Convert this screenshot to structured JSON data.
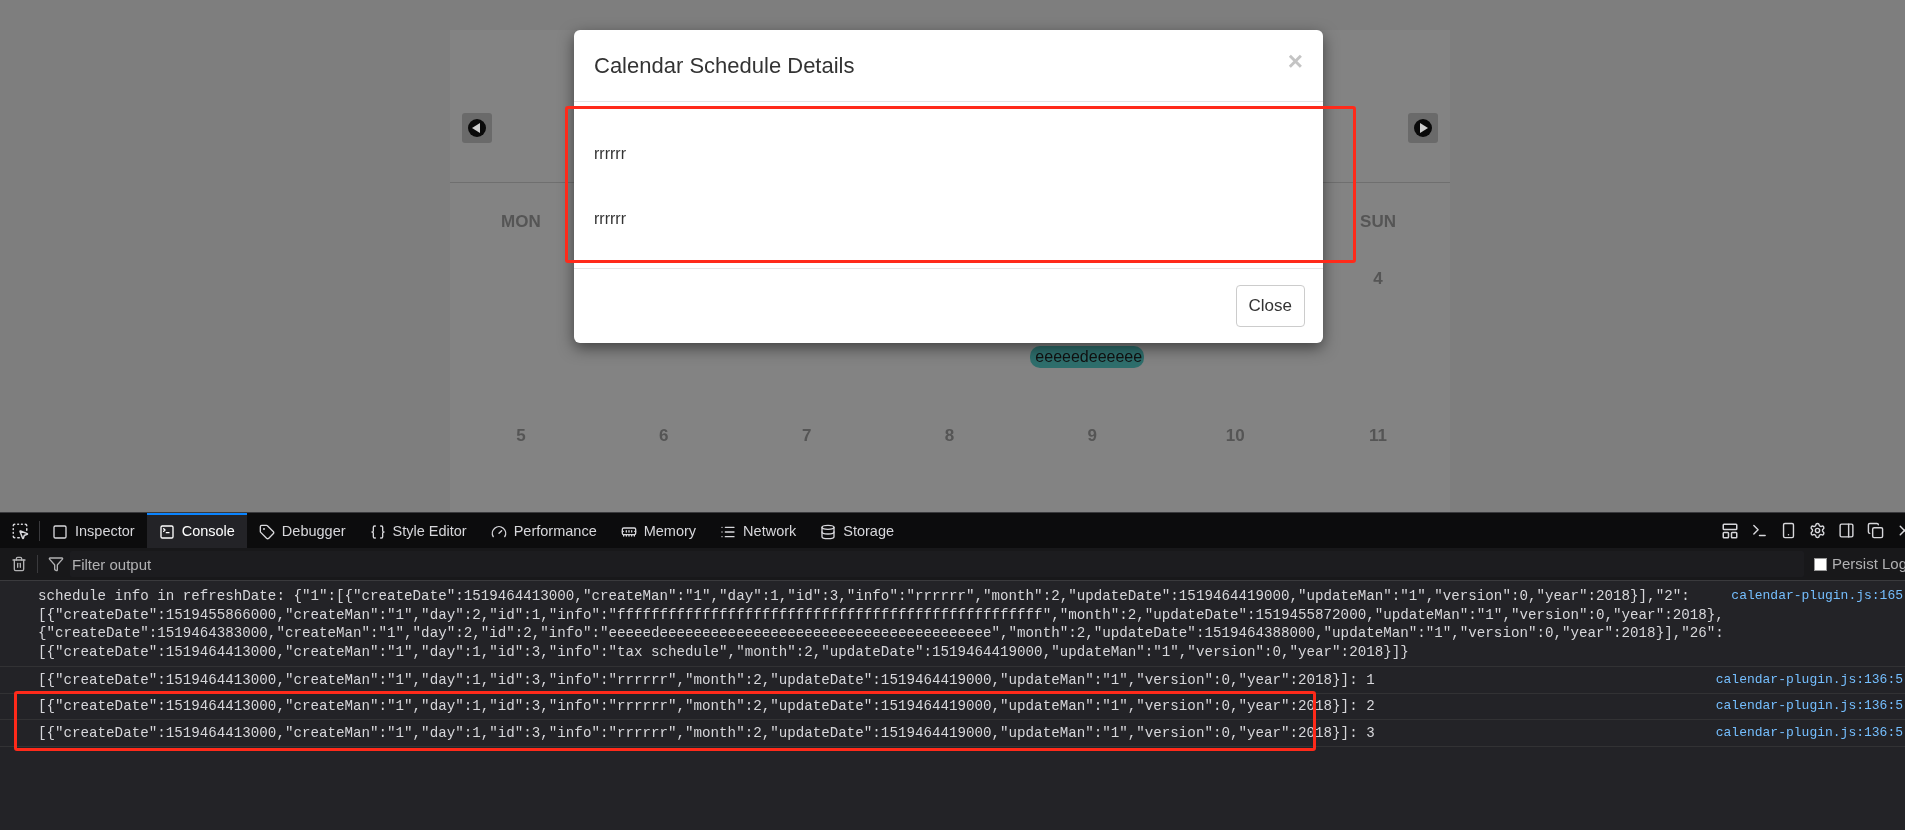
{
  "calendar": {
    "weekday_first": "MON",
    "weekday_last": "SUN",
    "week_1_last_day": "4",
    "event": "eeeeedeeeeee",
    "week_2": [
      "5",
      "6",
      "7",
      "8",
      "9",
      "10",
      "11"
    ]
  },
  "modal": {
    "title": "Calendar Schedule Details",
    "close_glyph": "×",
    "body_lines": [
      "rrrrrr",
      "rrrrrr"
    ],
    "button": "Close"
  },
  "devtools": {
    "tabs": [
      {
        "label": "Inspector",
        "selected": false
      },
      {
        "label": "Console",
        "selected": true
      },
      {
        "label": "Debugger",
        "selected": false
      },
      {
        "label": "Style Editor",
        "selected": false
      },
      {
        "label": "Performance",
        "selected": false
      },
      {
        "label": "Memory",
        "selected": false
      },
      {
        "label": "Network",
        "selected": false
      },
      {
        "label": "Storage",
        "selected": false
      }
    ],
    "filter_placeholder": "Filter output",
    "persist": {
      "label": "Persist Log",
      "checked": false
    },
    "messages": [
      {
        "lines": [
          "schedule info in refreshDate: {\"1\":[{\"createDate\":1519464413000,\"createMan\":\"1\",\"day\":1,\"id\":3,\"info\":\"rrrrrr\",\"month\":2,\"updateDate\":1519464419000,\"updateMan\":\"1\",\"version\":0,\"year\":2018}],\"2\":",
          "[{\"createDate\":1519455866000,\"createMan\":\"1\",\"day\":2,\"id\":1,\"info\":\"ffffffffffffffffffffffffffffffffffffffffffffffffff\",\"month\":2,\"updateDate\":1519455872000,\"updateMan\":\"1\",\"version\":0,\"year\":2018},",
          "{\"createDate\":1519464383000,\"createMan\":\"1\",\"day\":2,\"id\":2,\"info\":\"eeeeedeeeeeeeeeeeeeeeeeeeeeeeeeeeeeeeeeeeeeee\",\"month\":2,\"updateDate\":1519464388000,\"updateMan\":\"1\",\"version\":0,\"year\":2018}],\"26\":",
          "[{\"createDate\":1519464413000,\"createMan\":\"1\",\"day\":1,\"id\":3,\"info\":\"tax schedule\",\"month\":2,\"updateDate\":1519464419000,\"updateMan\":\"1\",\"version\":0,\"year\":2018}]}"
        ],
        "source": "calendar-plugin.js:165"
      },
      {
        "lines": [
          "[{\"createDate\":1519464413000,\"createMan\":\"1\",\"day\":1,\"id\":3,\"info\":\"rrrrrr\",\"month\":2,\"updateDate\":1519464419000,\"updateMan\":\"1\",\"version\":0,\"year\":2018}]: 1"
        ],
        "source": "calendar-plugin.js:136:5"
      },
      {
        "lines": [
          "[{\"createDate\":1519464413000,\"createMan\":\"1\",\"day\":1,\"id\":3,\"info\":\"rrrrrr\",\"month\":2,\"updateDate\":1519464419000,\"updateMan\":\"1\",\"version\":0,\"year\":2018}]: 2"
        ],
        "source": "calendar-plugin.js:136:5"
      },
      {
        "lines": [
          "[{\"createDate\":1519464413000,\"createMan\":\"1\",\"day\":1,\"id\":3,\"info\":\"rrrrrr\",\"month\":2,\"updateDate\":1519464419000,\"updateMan\":\"1\",\"version\":0,\"year\":2018}]: 3"
        ],
        "source": "calendar-plugin.js:136:5"
      }
    ]
  }
}
